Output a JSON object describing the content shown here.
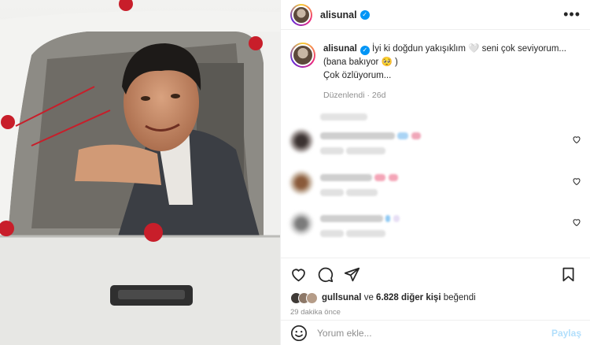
{
  "post": {
    "username": "alisunal",
    "verified": true,
    "caption": {
      "username": "alisunal",
      "line1": "İyi ki doğdun yakışıklım 🤍 seni çok seviyorum... (bana bakıyor 🥺 )",
      "line2": "Çok özlüyorum...",
      "edited": "Düzenlendi",
      "age": "26d"
    }
  },
  "likes": {
    "first_liker": "gullsunal",
    "joiner": "ve",
    "others": "6.828 diğer kişi",
    "suffix": "beğendi",
    "time": "29 dakika önce"
  },
  "composer": {
    "placeholder": "Yorum ekle...",
    "share_label": "Paylaş"
  },
  "icons": {
    "more": "more-options-icon",
    "like": "heart-icon",
    "comment": "comment-icon",
    "share": "send-icon",
    "save": "bookmark-icon",
    "emoji": "emoji-icon"
  },
  "colors": {
    "verified": "#0095f6",
    "share_disabled": "#b2dffc",
    "muted": "#8e8e8e"
  }
}
